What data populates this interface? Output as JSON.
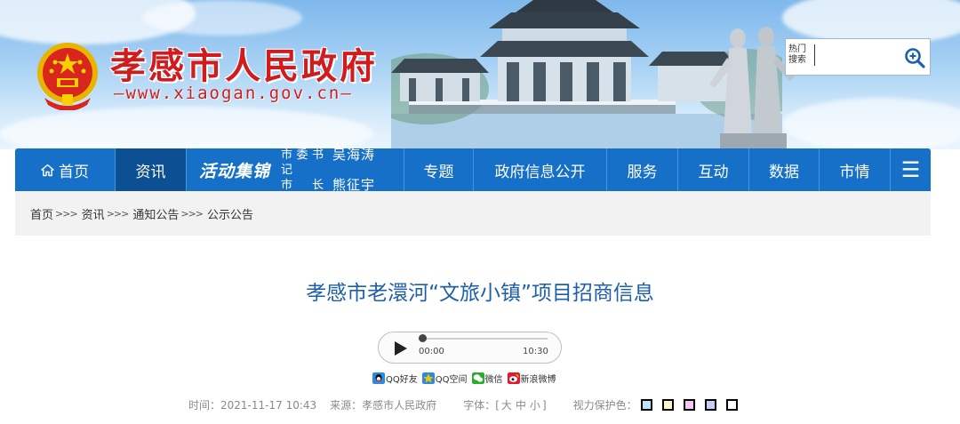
{
  "header": {
    "site_title": "孝感市人民政府",
    "site_url": "—www.xiaogan.gov.cn—",
    "search": {
      "hot_label_1": "热门",
      "hot_label_2": "搜索",
      "value": "",
      "placeholder": ""
    }
  },
  "nav": {
    "home": "首页",
    "news": "资讯",
    "activity_title": "活动集锦",
    "activity_role_1": "市委书记",
    "activity_name_1": "吴海涛",
    "activity_role_2": "市长",
    "activity_name_2": "熊征宇",
    "topics": "专题",
    "gov_info": "政府信息公开",
    "services": "服务",
    "interaction": "互动",
    "data": "数据",
    "market": "市情",
    "menu_icon": "☰"
  },
  "breadcrumb": {
    "items": [
      "首页",
      "资讯",
      "通知公告",
      "公示公告"
    ],
    "separator": ">>>"
  },
  "article": {
    "title": "孝感市老澴河“文旅小镇”项目招商信息",
    "audio": {
      "current": "00:00",
      "duration": "10:30",
      "progress": 0
    },
    "share": {
      "qq_friend": "QQ好友",
      "qq_zone": "QQ空间",
      "wechat": "微信",
      "weibo": "新浪微博"
    },
    "meta": {
      "time_label": "时间：",
      "time_value": "2021-11-17 10:43",
      "source_label": "来源：",
      "source_value": "孝感市人民政府",
      "font_label": "字体：",
      "font_open": "[",
      "font_large": "大",
      "font_medium": "中",
      "font_small": "小",
      "font_close": "]",
      "eye_care_label": "视力保护色："
    },
    "eye_care_colors": [
      "#bde3f8",
      "#fbf6c8",
      "#f6c6f4",
      "#c5cdf8",
      "#ffffff"
    ]
  },
  "colors": {
    "nav_bg": "#1670c8",
    "nav_active": "#0d4f93",
    "title_red": "#d01c1c",
    "article_title": "#1f5fa8"
  }
}
